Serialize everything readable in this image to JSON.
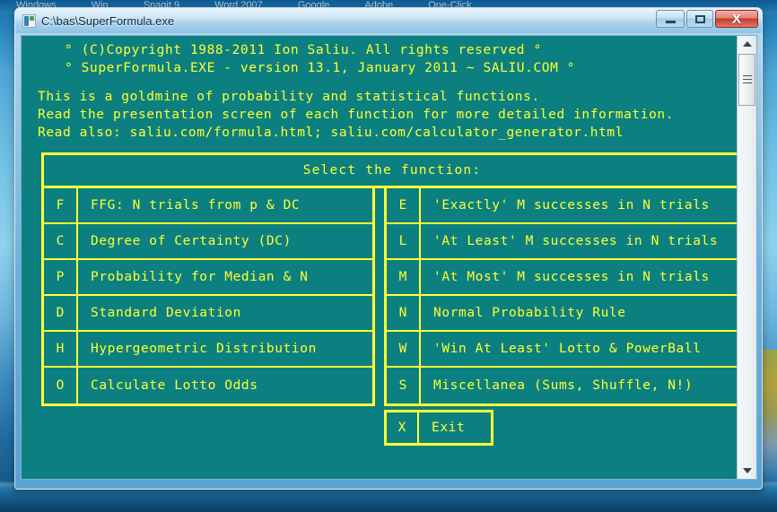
{
  "desktop": {
    "bookmarks": [
      {
        "label": "Windows"
      },
      {
        "label": "Win"
      },
      {
        "label": "Snagit 9"
      },
      {
        "label": "Word 2007"
      },
      {
        "label": "Google"
      },
      {
        "label": "Adobe"
      },
      {
        "label": "One-Click"
      }
    ]
  },
  "window": {
    "title": "C:\\bas\\SuperFormula.exe",
    "controls": {
      "minimize": "–",
      "maximize": "□",
      "close": "X"
    }
  },
  "console": {
    "header_lines": [
      "° (C)Copyright 1988-2011 Ion Saliu. All rights reserved °",
      "° SuperFormula.EXE - version 13.1, January 2011 ~ SALIU.COM °"
    ],
    "info_lines": [
      "This is a goldmine of probability and statistical functions.",
      "Read the presentation screen of each function for more detailed information.",
      "Read also: saliu.com/formula.html; saliu.com/calculator_generator.html"
    ],
    "menu_title": "Select the function:",
    "left_items": [
      {
        "key": "F",
        "label": "FFG: N trials from p & DC"
      },
      {
        "key": "C",
        "label": "Degree of Certainty (DC)"
      },
      {
        "key": "P",
        "label": "Probability for Median & N"
      },
      {
        "key": "D",
        "label": "Standard Deviation"
      },
      {
        "key": "H",
        "label": "Hypergeometric Distribution"
      },
      {
        "key": "O",
        "label": "Calculate Lotto Odds"
      }
    ],
    "right_items": [
      {
        "key": "E",
        "label": "'Exactly' M successes in N trials"
      },
      {
        "key": "L",
        "label": "'At Least' M successes in N trials"
      },
      {
        "key": "M",
        "label": "'At Most' M successes in N trials"
      },
      {
        "key": "N",
        "label": "Normal Probability Rule"
      },
      {
        "key": "W",
        "label": "'Win At Least' Lotto & PowerBall"
      },
      {
        "key": "S",
        "label": "Miscellanea (Sums, Shuffle, N!)"
      }
    ],
    "exit_item": {
      "key": "X",
      "label": "Exit"
    }
  },
  "colors": {
    "console_bg": "#0c8080",
    "console_fg": "#ffff33",
    "close_button": "#c6392a",
    "titlebar": "#cbe6f5"
  }
}
